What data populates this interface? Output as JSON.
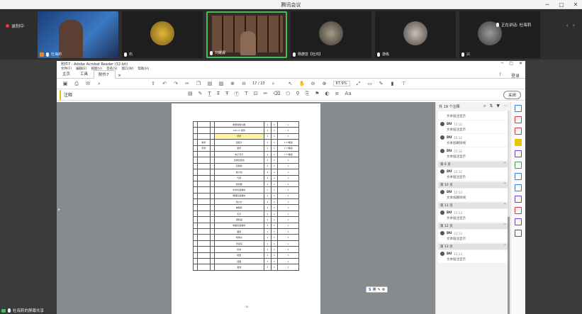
{
  "meeting": {
    "title": "腾讯会议",
    "recording_label": "录制中",
    "speaking_label": "正在讲话: 杜海莉",
    "screenshare_label": "杜海莉的屏幕共享",
    "participants": [
      {
        "name": "杜海莉",
        "host": true
      },
      {
        "name": "石"
      },
      {
        "name": "刘耀霖",
        "active": true
      },
      {
        "name": "杨德芸【杜鸿】"
      },
      {
        "name": "游栋"
      },
      {
        "name": "兴"
      }
    ],
    "window_controls": [
      "─",
      "▢",
      "✕"
    ]
  },
  "acrobat": {
    "title": "附件7 - Adobe Acrobat Reader (32-bit)",
    "menu": [
      "文件(F)",
      "编辑(E)",
      "视图(V)",
      "签名(S)",
      "窗口(W)",
      "帮助(H)"
    ],
    "tabs": [
      "主页",
      "工具",
      "附件7"
    ],
    "active_tab": "附件7",
    "help_icon": "?",
    "login_label": "登录",
    "page_indicator": "/ 23",
    "current_page": "17",
    "zoom": "67.9%",
    "comment_mode_label": "注释",
    "close_label": "关闭",
    "page_number_footer": "13"
  },
  "document": {
    "rows": [
      [
        "",
        "",
        "",
        "重量称量仪器",
        "1",
        "1",
        "1"
      ],
      [
        "",
        "",
        "",
        "100 ml 量筒",
        "1",
        "1",
        "1"
      ],
      [
        "",
        "",
        "",
        "烧杯",
        "1",
        "1",
        "1"
      ],
      [
        "",
        "数学",
        "",
        "温度计",
        "1",
        "1",
        "1个/每组"
      ],
      [
        "",
        "科学",
        "",
        "量杯",
        "1",
        "1",
        "1个/每组"
      ],
      [
        "",
        "",
        "",
        "电子天平",
        "1",
        "1",
        "1个/每组"
      ],
      [
        "",
        "",
        "",
        "生物显微镜",
        "1",
        "1",
        "1"
      ],
      [
        "",
        "",
        "",
        "显微镜",
        "1",
        "1",
        "1"
      ],
      [
        "",
        "",
        "",
        "放大镜",
        "1",
        "1",
        "1"
      ],
      [
        "",
        "",
        "",
        "光源",
        "1",
        "1",
        "1"
      ],
      [
        "",
        "",
        "",
        "燃烧器",
        "1",
        "1",
        "1"
      ],
      [
        "",
        "",
        "",
        "化学实验器材",
        "1",
        "1",
        "1"
      ],
      [
        "",
        "",
        "",
        "物理实验器材",
        "1",
        "1",
        "1"
      ],
      [
        "",
        "",
        "",
        "测力计",
        "1",
        "1",
        "1"
      ],
      [
        "",
        "",
        "",
        "弹簧秤",
        "1",
        "1",
        "1"
      ],
      [
        "",
        "",
        "",
        "天平",
        "1",
        "1",
        "1"
      ],
      [
        "",
        "",
        "",
        "滑轮组",
        "1",
        "1",
        "1"
      ],
      [
        "",
        "",
        "",
        "电路实验器材",
        "1",
        "1",
        "1"
      ],
      [
        "",
        "",
        "",
        "磁铁",
        "1",
        "1",
        "1"
      ],
      [
        "",
        "",
        "",
        "地球仪",
        "1",
        "1",
        "1"
      ],
      [
        "",
        "",
        "",
        "望远镜",
        "1",
        "1",
        "1"
      ],
      [
        "",
        "",
        "",
        "标本",
        "1",
        "1",
        "1"
      ],
      [
        "",
        "",
        "",
        "模型",
        "1",
        "1",
        "1"
      ],
      [
        "",
        "",
        "",
        "挂图",
        "1",
        "1",
        "1"
      ],
      [
        "",
        "",
        "",
        "其他",
        "1",
        "1",
        "1"
      ]
    ],
    "highlight_row": 2
  },
  "comments": {
    "count_label": "共 19 个注释",
    "groups": [
      {
        "page": "",
        "items": [
          {
            "user": "",
            "date": "",
            "text": "文本插注显示"
          }
        ]
      },
      {
        "page": "",
        "items": [
          {
            "user": "DU",
            "date": "15:12",
            "text": "文本插注显示"
          },
          {
            "user": "DU",
            "date": "15:12",
            "text": "文本加删除线"
          },
          {
            "user": "DU",
            "date": "15:12",
            "text": "文本插注显示"
          }
        ]
      },
      {
        "page": "第 6 页",
        "items": [
          {
            "user": "DU",
            "date": "15:12",
            "text": "文本插注显示"
          }
        ]
      },
      {
        "page": "第 10 页",
        "items": [
          {
            "user": "DU",
            "date": "15:13",
            "text": "文本加删除线"
          }
        ]
      },
      {
        "page": "第 11 页",
        "items": [
          {
            "user": "DU",
            "date": "15:13",
            "text": "文本插注显示"
          }
        ]
      },
      {
        "page": "第 12 页",
        "items": [
          {
            "user": "DU",
            "date": "15:13",
            "text": "文本插注显示"
          }
        ]
      },
      {
        "page": "第 13 页",
        "items": [
          {
            "user": "DU",
            "date": "15:13",
            "text": "文本插注显示"
          }
        ]
      }
    ]
  },
  "ime": {
    "label": "英"
  },
  "colors": {
    "accent_green": "#3fbf5a",
    "highlight_yellow": "#e8c300",
    "rail_icons": [
      "#2f7fd6",
      "#d03a3a",
      "#d03a3a",
      "#e8c300",
      "#6a3ad0",
      "#3aa04a",
      "#2f7fd6",
      "#2f7fd6",
      "#6a3ad0",
      "#d03a3a",
      "#6a3ad0",
      "#555555"
    ]
  }
}
